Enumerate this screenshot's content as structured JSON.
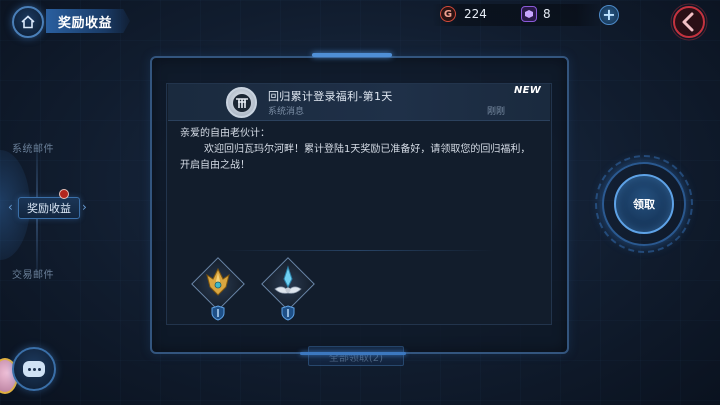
{
  "header": {
    "title": "奖励收益"
  },
  "currency": {
    "gold": {
      "icon_label": "G",
      "value": "224"
    },
    "gem": {
      "value": "8"
    }
  },
  "sidebar": {
    "items": [
      {
        "label": "系统邮件",
        "active": false
      },
      {
        "label": "奖励收益",
        "active": true,
        "has_notification": true
      },
      {
        "label": "交易邮件",
        "active": false
      }
    ]
  },
  "mail": {
    "title": "回归累计登录福利-第1天",
    "sender": "系统消息",
    "time": "刚刚",
    "badge": "NEW",
    "greeting": "亲爱的自由老伙计：",
    "body": "欢迎回归瓦玛尔河畔！累计登陆1天奖励已准备好，请领取您的回归福利，开启自由之战！",
    "rewards": [
      {
        "name": "golden-trident-emblem"
      },
      {
        "name": "blue-crystal-wing-emblem"
      }
    ]
  },
  "actions": {
    "claim_label": "领取",
    "bottom_label": "全部领取(2)"
  },
  "colors": {
    "accent": "#4f8fd6",
    "background": "#111d2f",
    "notification": "#b3261e"
  }
}
